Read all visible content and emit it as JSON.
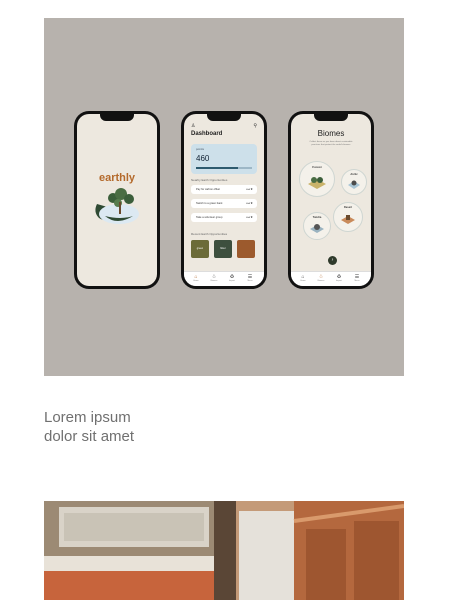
{
  "phone1": {
    "logo_text": "earthly"
  },
  "phone2": {
    "title": "Dashboard",
    "points_label": "points",
    "points_value": "460",
    "points_progress": 0.75,
    "section1": "Nearby Earth Opportunities",
    "opportunities": [
      {
        "label": "Pay for carbon offset",
        "stat": "••◂ ★"
      },
      {
        "label": "Switch to a green bank",
        "stat": "••◂ ★"
      },
      {
        "label": "Take a volunteer group",
        "stat": "••◂ ★"
      }
    ],
    "section2": "Recent Earth Opportunities",
    "tiles": [
      {
        "label": "green",
        "color": "#6b6b38"
      },
      {
        "label": "hiker",
        "color": "#3d4f3e"
      },
      {
        "label": "",
        "color": "#9c5a2d"
      }
    ],
    "tabs": [
      "Home",
      "Biomes",
      "Impact",
      "Menu"
    ]
  },
  "phone3": {
    "title": "Biomes",
    "subtitle": "Collect these as you learn about sustainable practices that protect the world's biomes",
    "biomes": [
      "Forest",
      "Arctic",
      "Tundra",
      "Desert"
    ],
    "tabs": [
      "Home",
      "Biomes",
      "Impact",
      "Menu"
    ]
  },
  "heading": {
    "line1": "Lorem ipsum",
    "line2": "dolor sit amet"
  },
  "colors": {
    "card_bg": "#b7b2ad",
    "screen_bg": "#ede8df",
    "brand": "#b46a2c"
  }
}
